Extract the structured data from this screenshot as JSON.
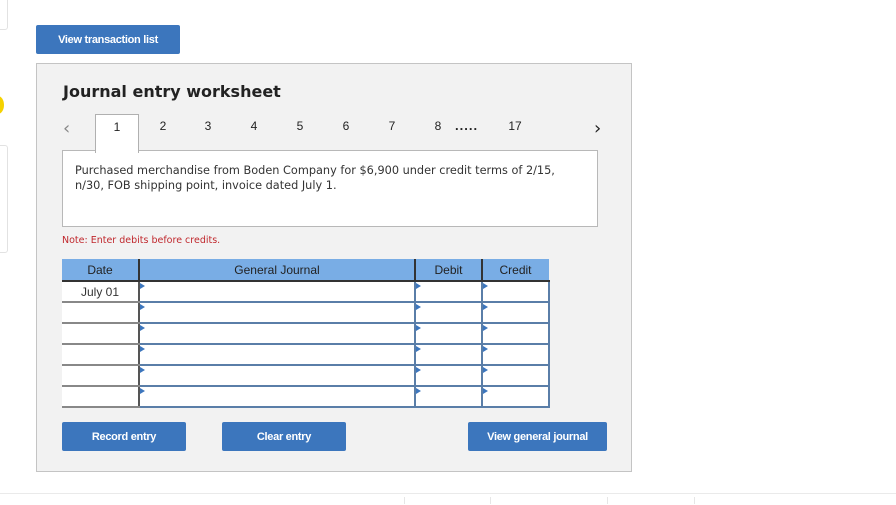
{
  "top_button": {
    "label": "View transaction list"
  },
  "worksheet": {
    "title": "Journal entry worksheet",
    "tabs": {
      "prev_icon": "‹",
      "next_icon": "›",
      "items": [
        "1",
        "2",
        "3",
        "4",
        "5",
        "6",
        "7",
        "8",
        "17"
      ],
      "ellipsis": ".....",
      "active": "1"
    },
    "description": "Purchased merchandise from Boden Company for $6,900 under credit terms of 2/15, n/30, FOB shipping point, invoice dated July 1.",
    "note": "Note: Enter debits before credits.",
    "table": {
      "headers": {
        "date": "Date",
        "account": "General Journal",
        "debit": "Debit",
        "credit": "Credit"
      },
      "rows": [
        {
          "date": "July 01",
          "account": "",
          "debit": "",
          "credit": ""
        },
        {
          "date": "",
          "account": "",
          "debit": "",
          "credit": ""
        },
        {
          "date": "",
          "account": "",
          "debit": "",
          "credit": ""
        },
        {
          "date": "",
          "account": "",
          "debit": "",
          "credit": ""
        },
        {
          "date": "",
          "account": "",
          "debit": "",
          "credit": ""
        },
        {
          "date": "",
          "account": "",
          "debit": "",
          "credit": ""
        }
      ]
    },
    "buttons": {
      "record": "Record entry",
      "clear": "Clear entry",
      "view_journal": "View general journal"
    }
  },
  "colors": {
    "button_blue": "#3c76bd",
    "header_blue": "#79ade5",
    "note_red": "#c0282d",
    "panel_bg": "#f2f2f2"
  }
}
